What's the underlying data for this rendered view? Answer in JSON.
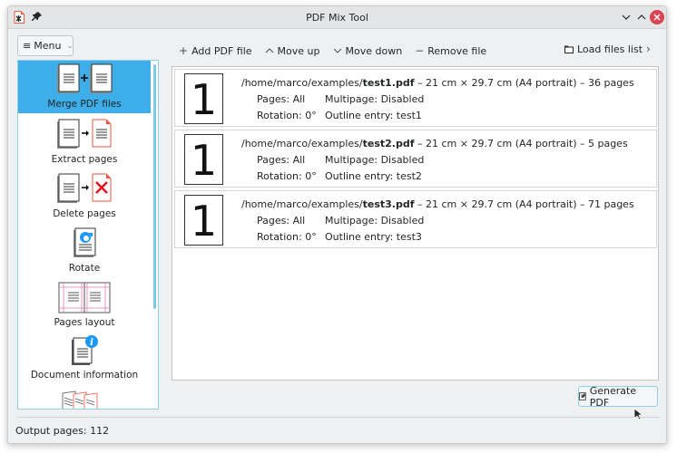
{
  "window": {
    "title": "PDF Mix Tool",
    "icons": [
      "app-icon",
      "pin-icon",
      "minimize-icon",
      "maximize-icon",
      "close-icon"
    ]
  },
  "menu": {
    "label": "Menu",
    "icon": "hamburger-icon"
  },
  "toolbar": {
    "add_pdf": {
      "label": "Add PDF file",
      "icon": "plus-icon"
    },
    "move_up": {
      "label": "Move up",
      "icon": "chevron-up-icon"
    },
    "move_down": {
      "label": "Move down",
      "icon": "chevron-down-icon"
    },
    "remove": {
      "label": "Remove file",
      "icon": "minus-icon"
    },
    "load_list": {
      "label": "Load files list",
      "icon": "folder-icon"
    },
    "more": {
      "icon": "chevron-right-icon"
    }
  },
  "sidebar": {
    "items": [
      {
        "label": "Merge PDF files",
        "selected": true
      },
      {
        "label": "Extract pages",
        "selected": false
      },
      {
        "label": "Delete pages",
        "selected": false
      },
      {
        "label": "Rotate",
        "selected": false
      },
      {
        "label": "Pages layout",
        "selected": false
      },
      {
        "label": "Document information",
        "selected": false
      },
      {
        "label": "",
        "selected": false
      }
    ]
  },
  "files": [
    {
      "thumb": "1",
      "dir": "/home/marco/examples/",
      "name": "test1.pdf",
      "details": " – 21 cm × 29.7 cm (A4 portrait) – 36 pages",
      "pages": "Pages: All",
      "multipage": "Multipage: Disabled",
      "rotation": "Rotation: 0°",
      "outline": "Outline entry: test1"
    },
    {
      "thumb": "1",
      "dir": "/home/marco/examples/",
      "name": "test2.pdf",
      "details": " – 21 cm × 29.7 cm (A4 portrait) – 5 pages",
      "pages": "Pages: All",
      "multipage": "Multipage: Disabled",
      "rotation": "Rotation: 0°",
      "outline": "Outline entry: test2"
    },
    {
      "thumb": "1",
      "dir": "/home/marco/examples/",
      "name": "test3.pdf",
      "details": " – 21 cm × 29.7 cm (A4 portrait) – 71 pages",
      "pages": "Pages: All",
      "multipage": "Multipage: Disabled",
      "rotation": "Rotation: 0°",
      "outline": "Outline entry: test3"
    }
  ],
  "generate": {
    "label": "Generate PDF",
    "icon": "document-save-icon"
  },
  "status": {
    "output_pages": "Output pages: 112"
  },
  "colors": {
    "accent": "#3daee9",
    "close": "#da4453",
    "window_bg": "#eff0f1"
  }
}
